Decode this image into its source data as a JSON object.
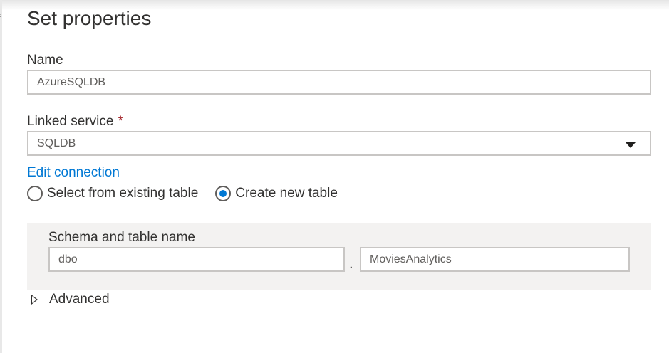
{
  "panel": {
    "title": "Set properties"
  },
  "name_field": {
    "label": "Name",
    "value": "AzureSQLDB"
  },
  "linked_service": {
    "label": "Linked service",
    "required_mark": "*",
    "value": "SQLDB"
  },
  "edit_connection_label": "Edit connection",
  "table_option": {
    "options": [
      "Select from existing table",
      "Create new table"
    ],
    "selected": "Create new table"
  },
  "schema_table": {
    "label": "Schema and table name",
    "schema_value": "dbo",
    "separator": ".",
    "table_value": "MoviesAnalytics"
  },
  "advanced": {
    "label": "Advanced"
  },
  "colors": {
    "accent": "#0078d4",
    "required": "#a4262c",
    "section_bg": "#f3f2f1"
  },
  "icons": [
    "chevron-down-icon",
    "triangle-right-icon"
  ]
}
